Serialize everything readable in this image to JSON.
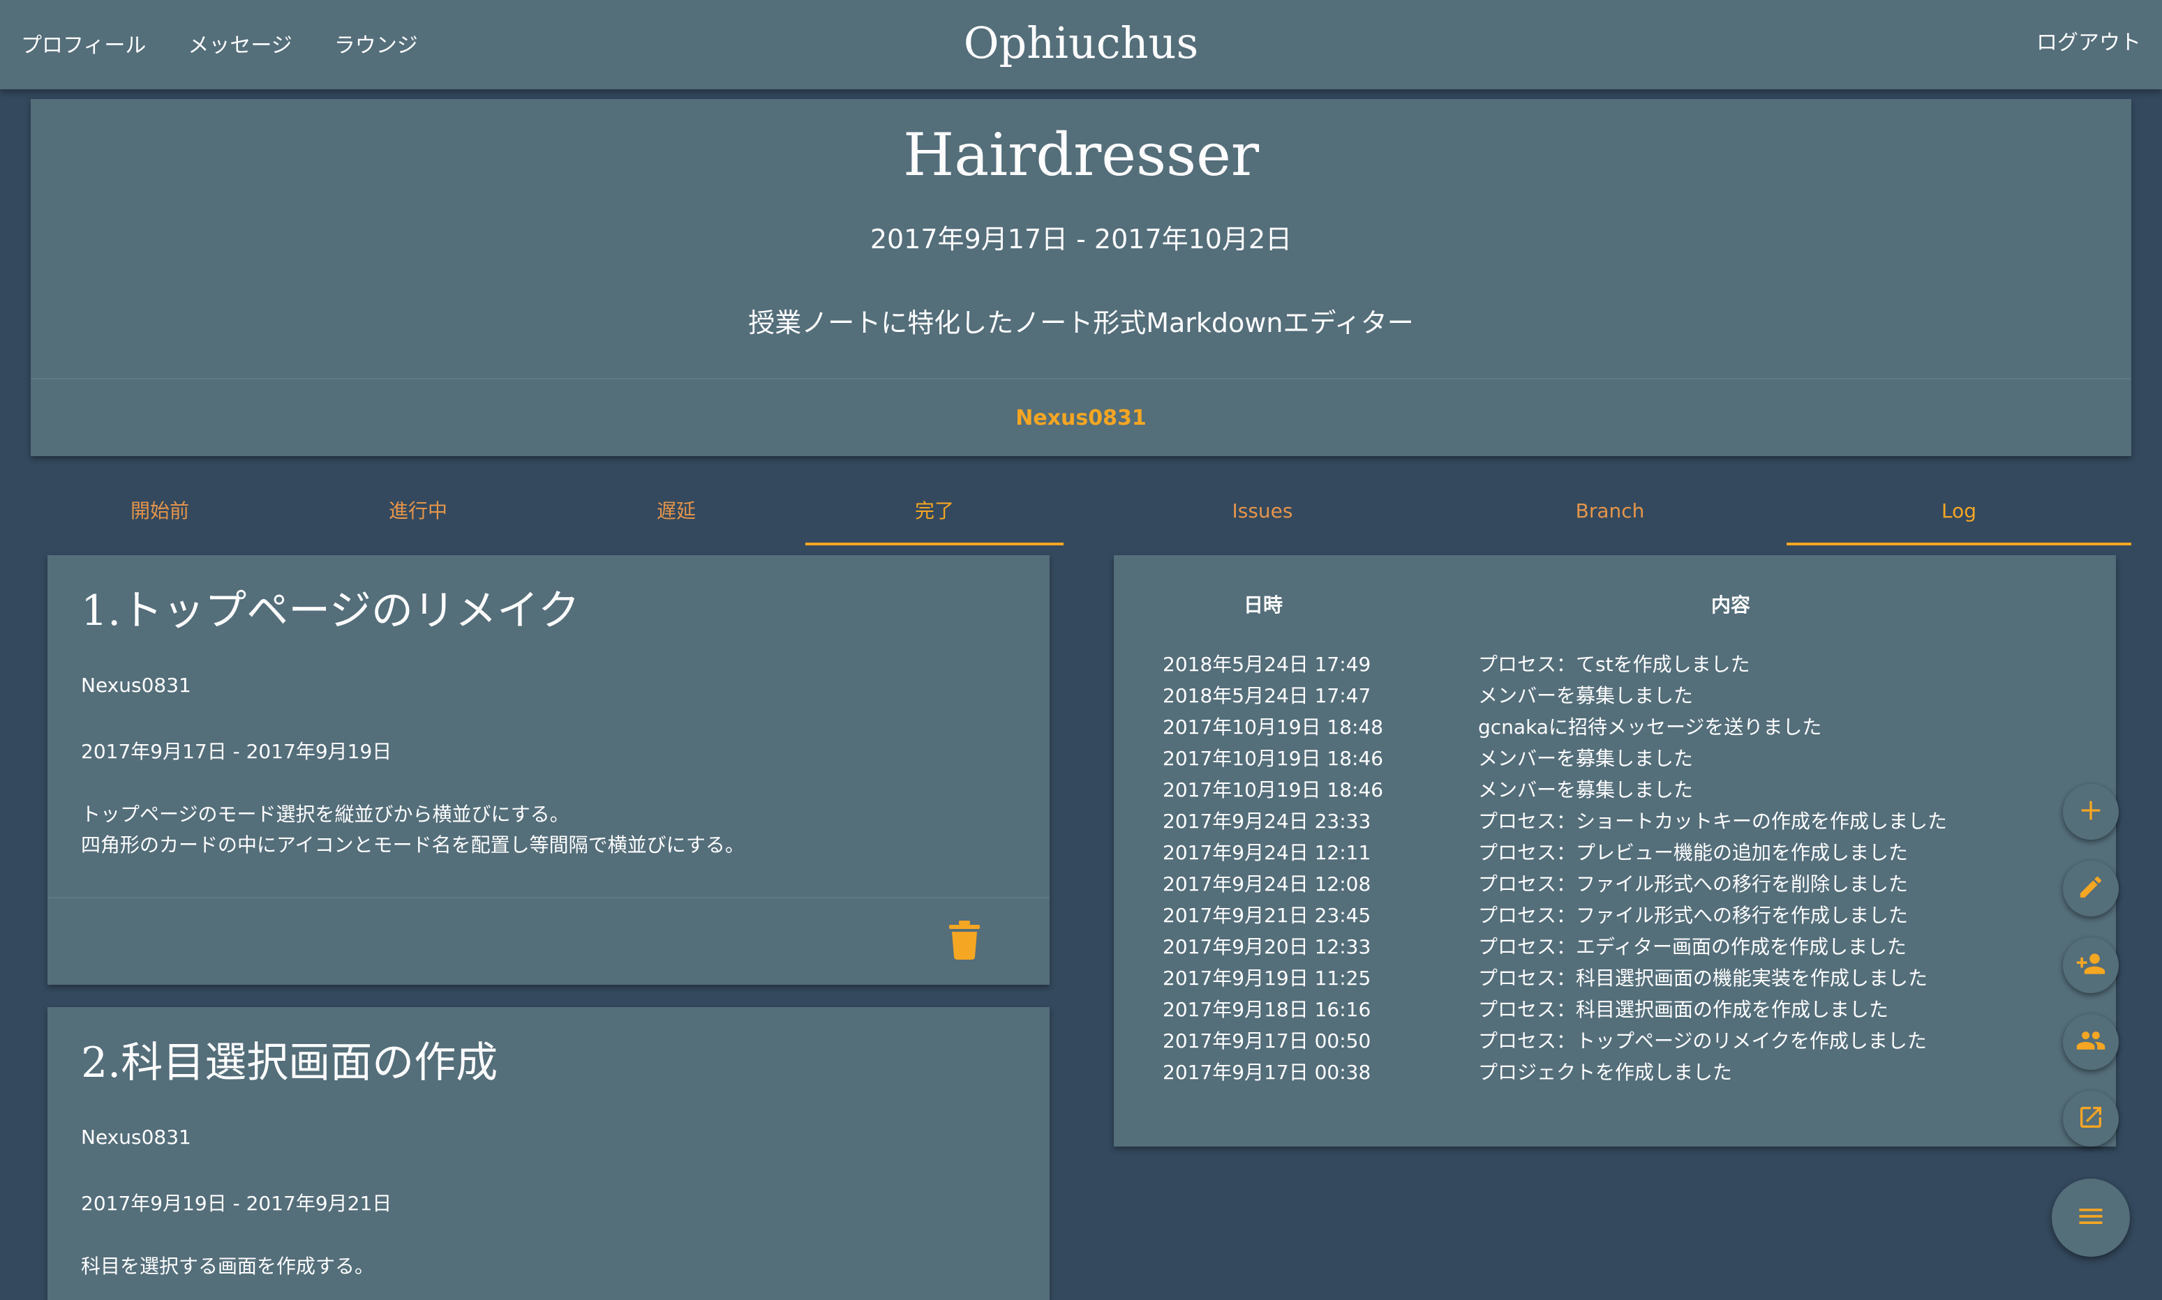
{
  "nav": {
    "profile": "プロフィール",
    "messages": "メッセージ",
    "lounge": "ラウンジ",
    "brand": "Ophiuchus",
    "logout": "ログアウト"
  },
  "project": {
    "title": "Hairdresser",
    "period": "2017年9月17日 - 2017年10月2日",
    "description": "授業ノートに特化したノート形式Markdownエディター",
    "owner": "Nexus0831"
  },
  "status_tabs": [
    {
      "label": "開始前",
      "active": false
    },
    {
      "label": "進行中",
      "active": false
    },
    {
      "label": "遅延",
      "active": false
    },
    {
      "label": "完了",
      "active": true
    }
  ],
  "info_tabs": [
    {
      "label": "Issues",
      "active": false
    },
    {
      "label": "Branch",
      "active": false
    },
    {
      "label": "Log",
      "active": true
    }
  ],
  "processes": [
    {
      "title": "1.トップページのリメイク",
      "owner": "Nexus0831",
      "period": "2017年9月17日 - 2017年9月19日",
      "description": "トップページのモード選択を縦並びから横並びにする。\n四角形のカードの中にアイコンとモード名を配置し等間隔で横並びにする。",
      "delete_icon": "trash-icon"
    },
    {
      "title": "2.科目選択画面の作成",
      "owner": "Nexus0831",
      "period": "2017年9月19日 - 2017年9月21日",
      "description": "科目を選択する画面を作成する。"
    }
  ],
  "log": {
    "header_date": "日時",
    "header_content": "内容",
    "rows": [
      {
        "date": "2018年5月24日 17:49",
        "content": "プロセス：てstを作成しました"
      },
      {
        "date": "2018年5月24日 17:47",
        "content": "メンバーを募集しました"
      },
      {
        "date": "2017年10月19日 18:48",
        "content": "gcnakaに招待メッセージを送りました"
      },
      {
        "date": "2017年10月19日 18:46",
        "content": "メンバーを募集しました"
      },
      {
        "date": "2017年10月19日 18:46",
        "content": "メンバーを募集しました"
      },
      {
        "date": "2017年9月24日 23:33",
        "content": "プロセス：ショートカットキーの作成を作成しました"
      },
      {
        "date": "2017年9月24日 12:11",
        "content": "プロセス：プレビュー機能の追加を作成しました"
      },
      {
        "date": "2017年9月24日 12:08",
        "content": "プロセス：ファイル形式への移行を削除しました"
      },
      {
        "date": "2017年9月21日 23:45",
        "content": "プロセス：ファイル形式への移行を作成しました"
      },
      {
        "date": "2017年9月20日 12:33",
        "content": "プロセス：エディター画面の作成を作成しました"
      },
      {
        "date": "2017年9月19日 11:25",
        "content": "プロセス：科目選択画面の機能実装を作成しました"
      },
      {
        "date": "2017年9月18日 16:16",
        "content": "プロセス：科目選択画面の作成を作成しました"
      },
      {
        "date": "2017年9月17日 00:50",
        "content": "プロセス：トップページのリメイクを作成しました"
      },
      {
        "date": "2017年9月17日 00:38",
        "content": "プロジェクトを作成しました"
      }
    ]
  },
  "fab_icons": [
    "plus-icon",
    "pencil-icon",
    "person-add-icon",
    "group-icon",
    "open-external-icon",
    "menu-icon"
  ],
  "colors": {
    "background": "#34495e",
    "surface": "#546e7a",
    "accent": "#f5a623"
  }
}
